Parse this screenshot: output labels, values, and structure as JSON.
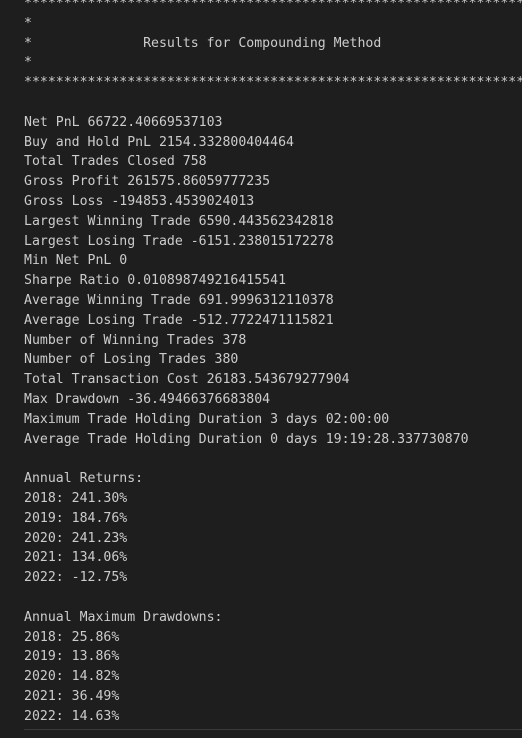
{
  "banner": {
    "border": "*****************************************************************************",
    "side": "*                                                                           *",
    "title_row": "*              Results for Compounding Method                               *"
  },
  "stats": [
    "Net PnL 66722.40669537103",
    "Buy and Hold PnL 2154.332800404464",
    "Total Trades Closed 758",
    "Gross Profit 261575.86059777235",
    "Gross Loss -194853.4539024013",
    "Largest Winning Trade 6590.443562342818",
    "Largest Losing Trade -6151.238015172278",
    "Min Net PnL 0",
    "Sharpe Ratio 0.010898749216415541",
    "Average Winning Trade 691.9996312110378",
    "Average Losing Trade -512.7722471115821",
    "Number of Winning Trades 378",
    "Number of Losing Trades 380",
    "Total Transaction Cost 26183.543679277904",
    "Max Drawdown -36.49466376683804",
    "Maximum Trade Holding Duration 3 days 02:00:00",
    "Average Trade Holding Duration 0 days 19:19:28.337730870"
  ],
  "annual_returns": {
    "heading": "Annual Returns:",
    "rows": [
      "2018: 241.30%",
      "2019: 184.76%",
      "2020: 241.23%",
      "2021: 134.06%",
      "2022: -12.75%"
    ]
  },
  "annual_drawdowns": {
    "heading": "Annual Maximum Drawdowns:",
    "rows": [
      "2018: 25.86%",
      "2019: 13.86%",
      "2020: 14.82%",
      "2021: 36.49%",
      "2022: 14.63%"
    ]
  }
}
